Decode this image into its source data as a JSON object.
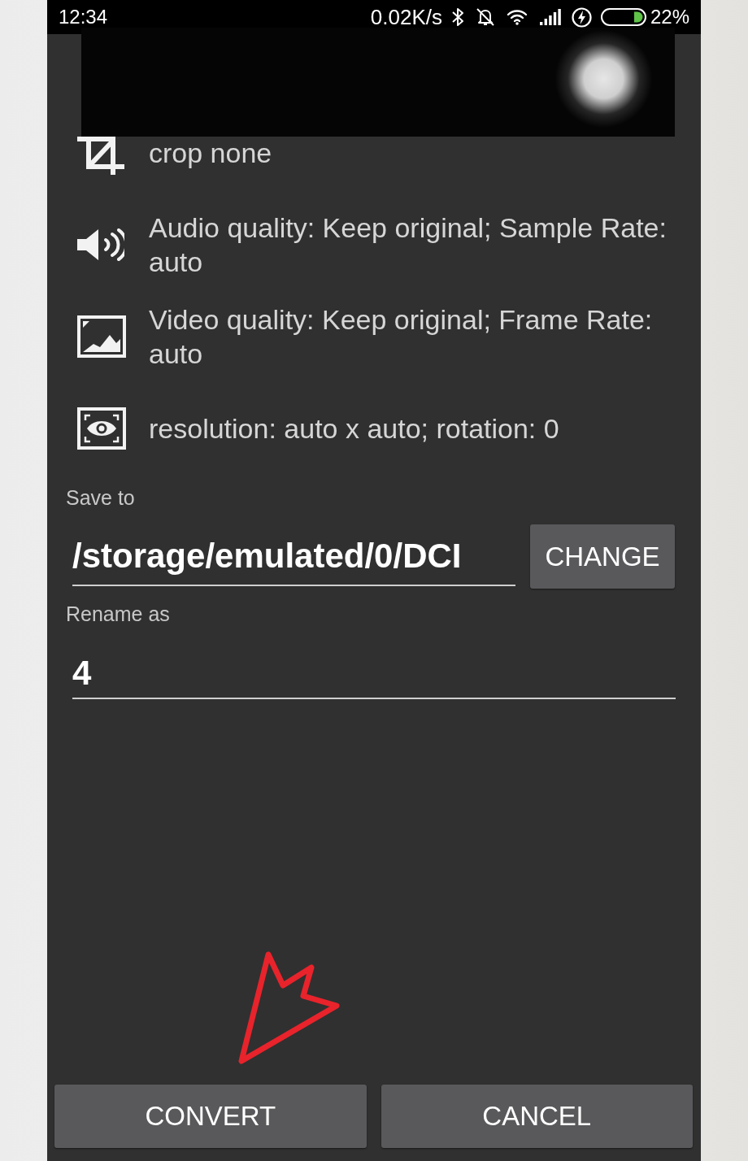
{
  "status_bar": {
    "time": "12:34",
    "network_speed": "0.02K/s",
    "battery": "22%"
  },
  "settings": [
    {
      "kind": "crop",
      "text": "crop none"
    },
    {
      "kind": "audio",
      "text": "Audio quality: Keep original; Sample Rate: auto"
    },
    {
      "kind": "video",
      "text": "Video quality: Keep original; Frame Rate: auto"
    },
    {
      "kind": "resolution",
      "text": "resolution: auto x auto; rotation: 0"
    }
  ],
  "save_to": {
    "label": "Save to",
    "value": "/storage/emulated/0/DCI",
    "button": "CHANGE"
  },
  "rename_as": {
    "label": "Rename as",
    "value": "4"
  },
  "buttons": [
    "CONVERT",
    "CANCEL"
  ]
}
